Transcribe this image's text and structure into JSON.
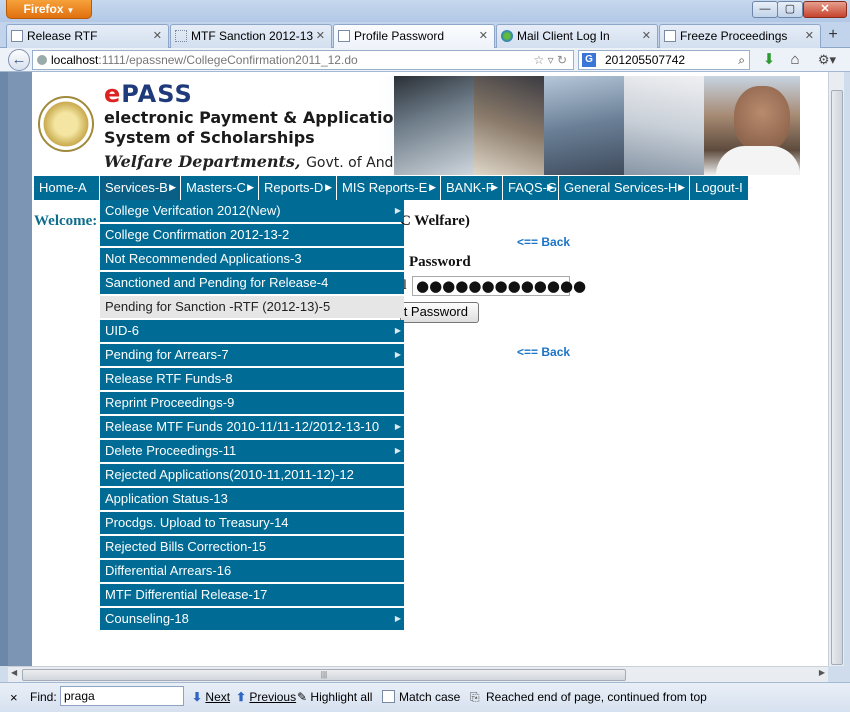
{
  "browser": {
    "app_button": "Firefox",
    "window_controls": [
      "—",
      "▢",
      "✕"
    ],
    "tabs": [
      {
        "label": "Release RTF",
        "active": false
      },
      {
        "label": "MTF Sanction 2012-13",
        "active": false
      },
      {
        "label": "Profile Password",
        "active": true
      },
      {
        "label": "Mail Client Log In",
        "active": false
      },
      {
        "label": "Freeze Proceedings",
        "active": false
      }
    ],
    "url_host": "localhost",
    "url_rest": ":1111/epassnew/CollegeConfirmation2011_12.do",
    "search_value": "201205507742",
    "search_engine_icon": "G"
  },
  "banner": {
    "logo_e": "e",
    "logo_rest": "PASS",
    "line1": "electronic Payment & Application",
    "line2": "System of Scholarships",
    "line3": "Welfare Departments,",
    "line3b": "Govt. of Andhra Pradesh"
  },
  "menu": [
    {
      "label": "Home-A",
      "submenu": false
    },
    {
      "label": "Services-B",
      "submenu": true
    },
    {
      "label": "Masters-C",
      "submenu": true
    },
    {
      "label": "Reports-D",
      "submenu": true
    },
    {
      "label": "MIS Reports-E",
      "submenu": true
    },
    {
      "label": "BANK-F",
      "submenu": true
    },
    {
      "label": "FAQS-G",
      "submenu": true
    },
    {
      "label": "General Services-H",
      "submenu": true
    },
    {
      "label": "Logout-I",
      "submenu": false
    }
  ],
  "dropdown": [
    {
      "label": "College Verifcation 2012(New)",
      "submenu": true
    },
    {
      "label": "College Confirmation 2012-13-2",
      "submenu": false
    },
    {
      "label": "Not Recommended Applications-3",
      "submenu": false
    },
    {
      "label": "Sanctioned and Pending for Release-4",
      "submenu": false
    },
    {
      "label": "Pending for Sanction -RTF (2012-13)-5",
      "submenu": false,
      "highlighted": true
    },
    {
      "label": "UID-6",
      "submenu": true
    },
    {
      "label": "Pending for Arrears-7",
      "submenu": true
    },
    {
      "label": "Release RTF Funds-8",
      "submenu": false
    },
    {
      "label": "Reprint Proceedings-9",
      "submenu": false
    },
    {
      "label": "Release MTF Funds 2010-11/11-12/2012-13-10",
      "submenu": true
    },
    {
      "label": "Delete Proceedings-11",
      "submenu": true
    },
    {
      "label": "Rejected Applications(2010-11,2011-12)-12",
      "submenu": false
    },
    {
      "label": "Application Status-13",
      "submenu": false
    },
    {
      "label": "Procdgs. Upload to Treasury-14",
      "submenu": false
    },
    {
      "label": "Rejected Bills Correction-15",
      "submenu": false
    },
    {
      "label": "Differential Arrears-16",
      "submenu": false
    },
    {
      "label": "MTF Differential Release-17",
      "submenu": false
    },
    {
      "label": "Counseling-18",
      "submenu": true
    }
  ],
  "page": {
    "welcome": "Welcome:",
    "welfare_fragment": "C Welfare)",
    "back_link_1": "<== Back",
    "password_heading": "Password",
    "label_tail": "l",
    "password_value": "●●●●●●●●●●●●●",
    "submit_label": "t Password",
    "back_link_2": "<== Back"
  },
  "findbar": {
    "close": "×",
    "label": "Find:",
    "query": "praga",
    "next": "Next",
    "previous": "Previous",
    "highlight": "Highlight all",
    "match_case": "Match case",
    "status": "Reached end of page, continued from top"
  },
  "colors": {
    "menu_bg": "#006b94",
    "menu_highlight": "#e6e6e6",
    "welcome_text": "#0f6d8c",
    "link": "#1a73c8"
  }
}
